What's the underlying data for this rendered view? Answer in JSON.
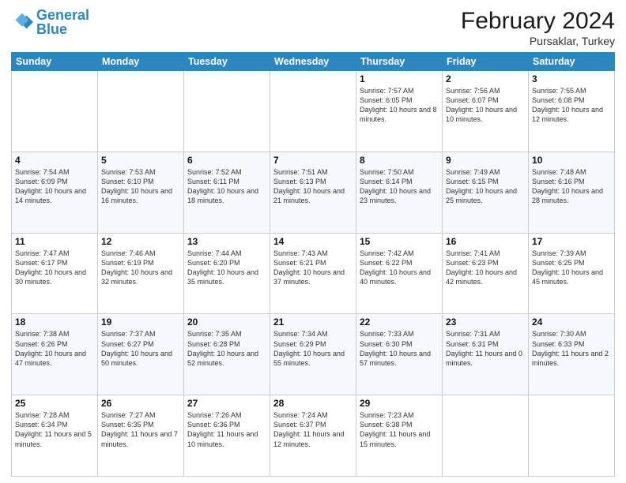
{
  "header": {
    "logo_line1": "General",
    "logo_line2": "Blue",
    "title": "February 2024",
    "subtitle": "Pursaklar, Turkey"
  },
  "days_of_week": [
    "Sunday",
    "Monday",
    "Tuesday",
    "Wednesday",
    "Thursday",
    "Friday",
    "Saturday"
  ],
  "weeks": [
    [
      {
        "day": "",
        "info": ""
      },
      {
        "day": "",
        "info": ""
      },
      {
        "day": "",
        "info": ""
      },
      {
        "day": "",
        "info": ""
      },
      {
        "day": "1",
        "info": "Sunrise: 7:57 AM\nSunset: 6:05 PM\nDaylight: 10 hours and 8 minutes."
      },
      {
        "day": "2",
        "info": "Sunrise: 7:56 AM\nSunset: 6:07 PM\nDaylight: 10 hours and 10 minutes."
      },
      {
        "day": "3",
        "info": "Sunrise: 7:55 AM\nSunset: 6:08 PM\nDaylight: 10 hours and 12 minutes."
      }
    ],
    [
      {
        "day": "4",
        "info": "Sunrise: 7:54 AM\nSunset: 6:09 PM\nDaylight: 10 hours and 14 minutes."
      },
      {
        "day": "5",
        "info": "Sunrise: 7:53 AM\nSunset: 6:10 PM\nDaylight: 10 hours and 16 minutes."
      },
      {
        "day": "6",
        "info": "Sunrise: 7:52 AM\nSunset: 6:11 PM\nDaylight: 10 hours and 18 minutes."
      },
      {
        "day": "7",
        "info": "Sunrise: 7:51 AM\nSunset: 6:13 PM\nDaylight: 10 hours and 21 minutes."
      },
      {
        "day": "8",
        "info": "Sunrise: 7:50 AM\nSunset: 6:14 PM\nDaylight: 10 hours and 23 minutes."
      },
      {
        "day": "9",
        "info": "Sunrise: 7:49 AM\nSunset: 6:15 PM\nDaylight: 10 hours and 25 minutes."
      },
      {
        "day": "10",
        "info": "Sunrise: 7:48 AM\nSunset: 6:16 PM\nDaylight: 10 hours and 28 minutes."
      }
    ],
    [
      {
        "day": "11",
        "info": "Sunrise: 7:47 AM\nSunset: 6:17 PM\nDaylight: 10 hours and 30 minutes."
      },
      {
        "day": "12",
        "info": "Sunrise: 7:46 AM\nSunset: 6:19 PM\nDaylight: 10 hours and 32 minutes."
      },
      {
        "day": "13",
        "info": "Sunrise: 7:44 AM\nSunset: 6:20 PM\nDaylight: 10 hours and 35 minutes."
      },
      {
        "day": "14",
        "info": "Sunrise: 7:43 AM\nSunset: 6:21 PM\nDaylight: 10 hours and 37 minutes."
      },
      {
        "day": "15",
        "info": "Sunrise: 7:42 AM\nSunset: 6:22 PM\nDaylight: 10 hours and 40 minutes."
      },
      {
        "day": "16",
        "info": "Sunrise: 7:41 AM\nSunset: 6:23 PM\nDaylight: 10 hours and 42 minutes."
      },
      {
        "day": "17",
        "info": "Sunrise: 7:39 AM\nSunset: 6:25 PM\nDaylight: 10 hours and 45 minutes."
      }
    ],
    [
      {
        "day": "18",
        "info": "Sunrise: 7:38 AM\nSunset: 6:26 PM\nDaylight: 10 hours and 47 minutes."
      },
      {
        "day": "19",
        "info": "Sunrise: 7:37 AM\nSunset: 6:27 PM\nDaylight: 10 hours and 50 minutes."
      },
      {
        "day": "20",
        "info": "Sunrise: 7:35 AM\nSunset: 6:28 PM\nDaylight: 10 hours and 52 minutes."
      },
      {
        "day": "21",
        "info": "Sunrise: 7:34 AM\nSunset: 6:29 PM\nDaylight: 10 hours and 55 minutes."
      },
      {
        "day": "22",
        "info": "Sunrise: 7:33 AM\nSunset: 6:30 PM\nDaylight: 10 hours and 57 minutes."
      },
      {
        "day": "23",
        "info": "Sunrise: 7:31 AM\nSunset: 6:31 PM\nDaylight: 11 hours and 0 minutes."
      },
      {
        "day": "24",
        "info": "Sunrise: 7:30 AM\nSunset: 6:33 PM\nDaylight: 11 hours and 2 minutes."
      }
    ],
    [
      {
        "day": "25",
        "info": "Sunrise: 7:28 AM\nSunset: 6:34 PM\nDaylight: 11 hours and 5 minutes."
      },
      {
        "day": "26",
        "info": "Sunrise: 7:27 AM\nSunset: 6:35 PM\nDaylight: 11 hours and 7 minutes."
      },
      {
        "day": "27",
        "info": "Sunrise: 7:26 AM\nSunset: 6:36 PM\nDaylight: 11 hours and 10 minutes."
      },
      {
        "day": "28",
        "info": "Sunrise: 7:24 AM\nSunset: 6:37 PM\nDaylight: 11 hours and 12 minutes."
      },
      {
        "day": "29",
        "info": "Sunrise: 7:23 AM\nSunset: 6:38 PM\nDaylight: 11 hours and 15 minutes."
      },
      {
        "day": "",
        "info": ""
      },
      {
        "day": "",
        "info": ""
      }
    ]
  ]
}
